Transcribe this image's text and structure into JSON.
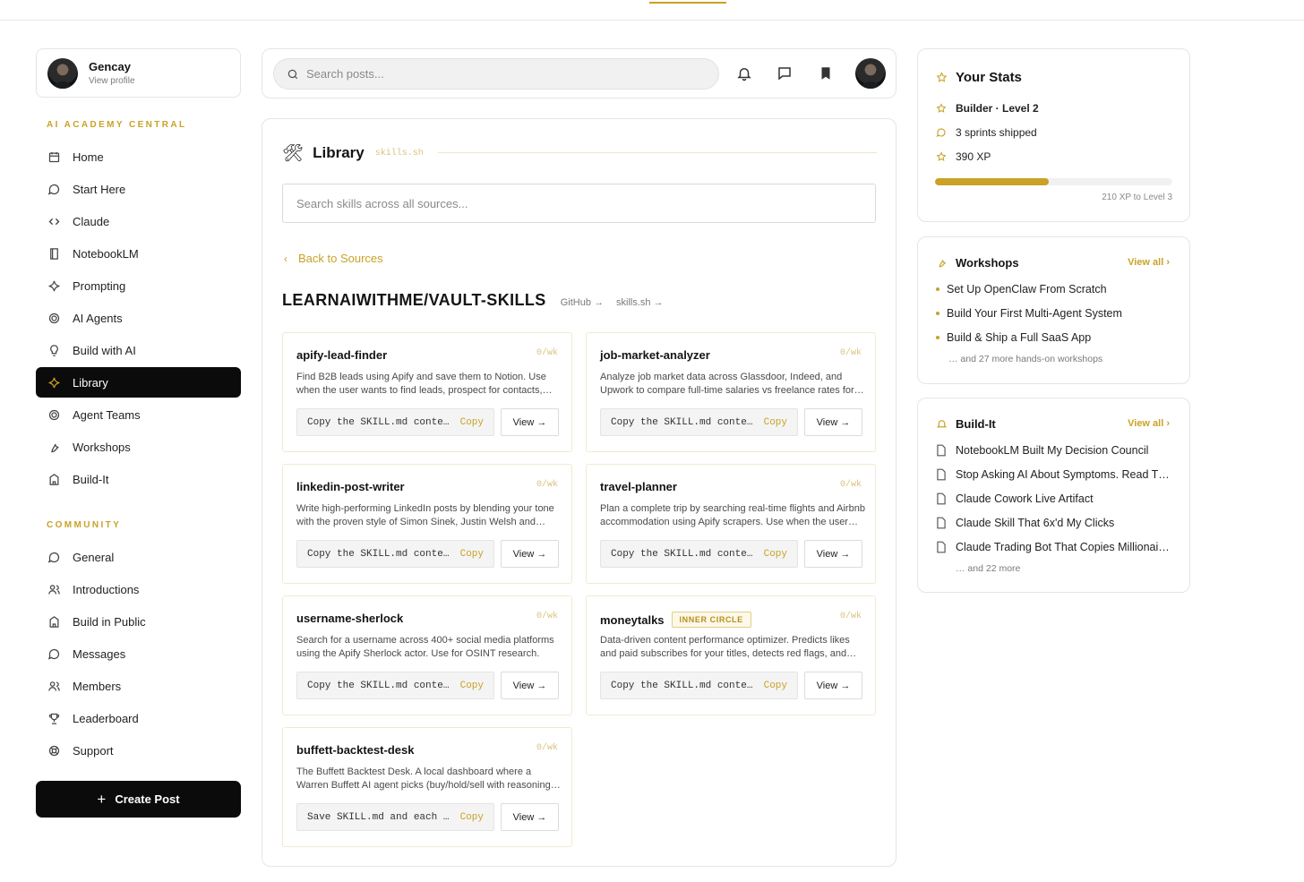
{
  "profile": {
    "name": "Gencay",
    "sub": "View profile"
  },
  "sections": {
    "academy": "AI ACADEMY CENTRAL",
    "community": "COMMUNITY"
  },
  "nav_academy": [
    {
      "label": "Home",
      "icon": "calendar-icon"
    },
    {
      "label": "Start Here",
      "icon": "chat-bubble-icon"
    },
    {
      "label": "Claude",
      "icon": "code-icon"
    },
    {
      "label": "NotebookLM",
      "icon": "book-icon"
    },
    {
      "label": "Prompting",
      "icon": "sparkle-icon"
    },
    {
      "label": "AI Agents",
      "icon": "target-icon"
    },
    {
      "label": "Build with AI",
      "icon": "lightbulb-icon"
    },
    {
      "label": "Library",
      "icon": "sparkle-icon",
      "active": true
    },
    {
      "label": "Agent Teams",
      "icon": "target-icon"
    },
    {
      "label": "Workshops",
      "icon": "wrench-icon"
    },
    {
      "label": "Build-It",
      "icon": "building-icon"
    }
  ],
  "nav_community": [
    {
      "label": "General",
      "icon": "chat-bubble-icon"
    },
    {
      "label": "Introductions",
      "icon": "users-icon"
    },
    {
      "label": "Build in Public",
      "icon": "building-icon"
    },
    {
      "label": "Messages",
      "icon": "chat-bubble-icon"
    },
    {
      "label": "Members",
      "icon": "users-icon"
    },
    {
      "label": "Leaderboard",
      "icon": "trophy-icon"
    },
    {
      "label": "Support",
      "icon": "lifebuoy-icon"
    }
  ],
  "create_post": "Create Post",
  "header": {
    "search_placeholder": "Search posts..."
  },
  "library": {
    "title": "Library",
    "tag": "skills.sh",
    "search_placeholder": "Search skills across all sources...",
    "back": "Back to Sources",
    "repo": "LEARNAIWITHME/VAULT-SKILLS",
    "repo_links": [
      "GitHub →",
      "skills.sh →"
    ],
    "skills": [
      {
        "name": "apify-lead-finder",
        "rate": "0/wk",
        "badge": "",
        "desc": "Find B2B leads using Apify and save them to Notion. Use when the user wants to find leads, prospect for contacts, build lead lists.",
        "cmd": "Copy the SKILL.md contents",
        "copy": "Copy",
        "view": "View →"
      },
      {
        "name": "job-market-analyzer",
        "rate": "0/wk",
        "badge": "",
        "desc": "Analyze job market data across Glassdoor, Indeed, and Upwork to compare full-time salaries vs freelance rates for any role.",
        "cmd": "Copy the SKILL.md contents",
        "copy": "Copy",
        "view": "View →"
      },
      {
        "name": "linkedin-post-writer",
        "rate": "0/wk",
        "badge": "",
        "desc": "Write high-performing LinkedIn posts by blending your tone with the proven style of Simon Sinek, Justin Welsh and others.",
        "cmd": "Copy the SKILL.md contents",
        "copy": "Copy",
        "view": "View →"
      },
      {
        "name": "travel-planner",
        "rate": "0/wk",
        "badge": "",
        "desc": "Plan a complete trip by searching real-time flights and Airbnb accommodation using Apify scrapers. Use when the user asks to plan a trip.",
        "cmd": "Copy the SKILL.md contents",
        "copy": "Copy",
        "view": "View →"
      },
      {
        "name": "username-sherlock",
        "rate": "0/wk",
        "badge": "",
        "desc": "Search for a username across 400+ social media platforms using the Apify Sherlock actor. Use for OSINT research.",
        "cmd": "Copy the SKILL.md contents",
        "copy": "Copy",
        "view": "View →"
      },
      {
        "name": "moneytalks",
        "rate": "0/wk",
        "badge": "INNER CIRCLE",
        "desc": "Data-driven content performance optimizer. Predicts likes and paid subscribes for your titles, detects red flags, and more.",
        "cmd": "Copy the SKILL.md contents",
        "copy": "Copy",
        "view": "View →"
      },
      {
        "name": "buffett-backtest-desk",
        "rate": "0/wk",
        "badge": "",
        "desc": "The Buffett Backtest Desk. A local dashboard where a Warren Buffett AI agent picks (buy/hold/sell with reasoning) and backtests them.",
        "cmd": "Save SKILL.md and each file",
        "copy": "Copy",
        "view": "View →"
      }
    ]
  },
  "stats": {
    "title": "Your Stats",
    "level": "Builder · Level 2",
    "sprints": "3 sprints shipped",
    "xp": "390 XP",
    "xp_progress": 0.48,
    "xp_note": "210 XP to Level 3"
  },
  "workshops": {
    "title": "Workshops",
    "view_all": "View all",
    "items": [
      "Set Up OpenClaw From Scratch",
      "Build Your First Multi-Agent System",
      "Build & Ship a Full SaaS App"
    ],
    "more": "… and 27 more hands-on workshops"
  },
  "buildit": {
    "title": "Build-It",
    "view_all": "View all",
    "items": [
      "NotebookLM Built My Decision Council",
      "Stop Asking AI About Symptoms. Read This",
      "Claude Cowork Live Artifact",
      "Claude Skill That 6x'd My Clicks",
      "Claude Trading Bot That Copies Millionaires"
    ],
    "more": "… and 22 more"
  },
  "colors": {
    "accent": "#c9a227",
    "dark": "#0b0b0b"
  }
}
